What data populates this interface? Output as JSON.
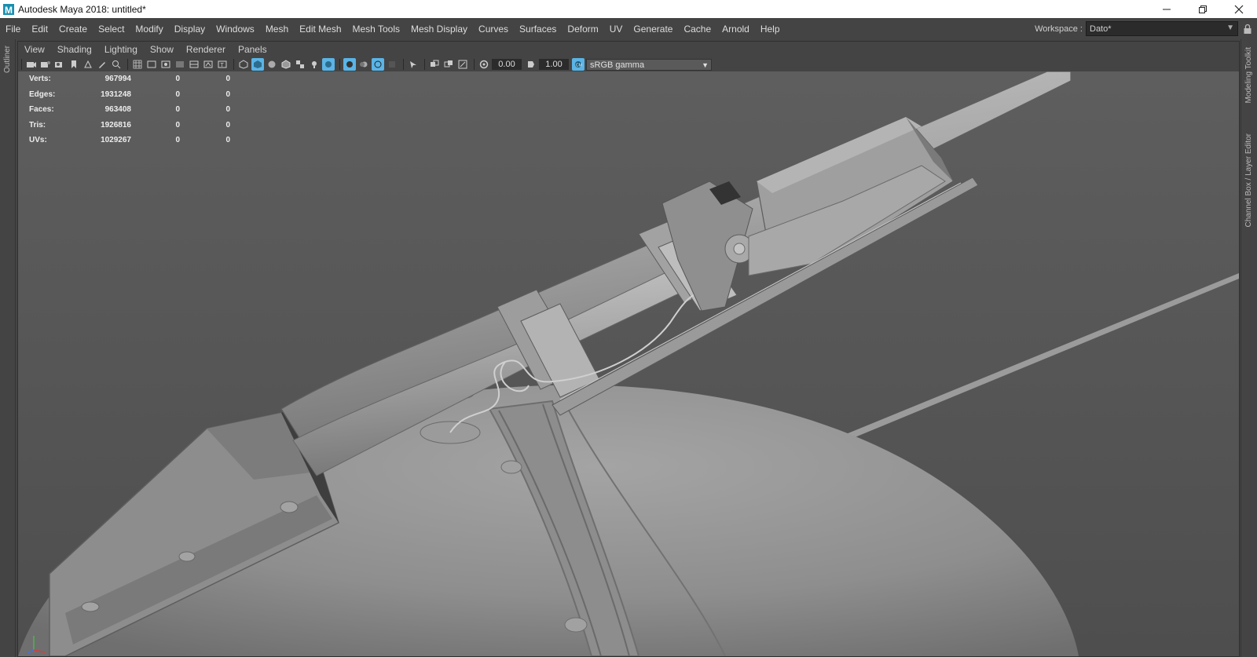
{
  "window": {
    "title": "Autodesk Maya 2018: untitled*",
    "logo_letter": "M"
  },
  "menubar": {
    "items": [
      "File",
      "Edit",
      "Create",
      "Select",
      "Modify",
      "Display",
      "Windows",
      "Mesh",
      "Edit Mesh",
      "Mesh Tools",
      "Mesh Display",
      "Curves",
      "Surfaces",
      "Deform",
      "UV",
      "Generate",
      "Cache",
      "Arnold",
      "Help"
    ],
    "workspace_label": "Workspace :",
    "workspace_value": "Dato*"
  },
  "side_tabs": {
    "left": "Outliner",
    "right_top": "Modeling Toolkit",
    "right_bottom": "Channel Box / Layer Editor"
  },
  "panel": {
    "menus": [
      "View",
      "Shading",
      "Lighting",
      "Show",
      "Renderer",
      "Panels"
    ],
    "toolbar": {
      "exposure": "0.00",
      "gamma": "1.00",
      "color_space": "sRGB gamma"
    }
  },
  "hud": {
    "rows": [
      {
        "label": "Verts:",
        "value": "967994",
        "selected": "0",
        "component": "0"
      },
      {
        "label": "Edges:",
        "value": "1931248",
        "selected": "0",
        "component": "0"
      },
      {
        "label": "Faces:",
        "value": "963408",
        "selected": "0",
        "component": "0"
      },
      {
        "label": "Tris:",
        "value": "1926816",
        "selected": "0",
        "component": "0"
      },
      {
        "label": "UVs:",
        "value": "1029267",
        "selected": "0",
        "component": "0"
      }
    ]
  },
  "colors": {
    "accent": "#5ab4e6",
    "viewport_bg": "#5c5c5c",
    "model": "#9a9a9a"
  }
}
